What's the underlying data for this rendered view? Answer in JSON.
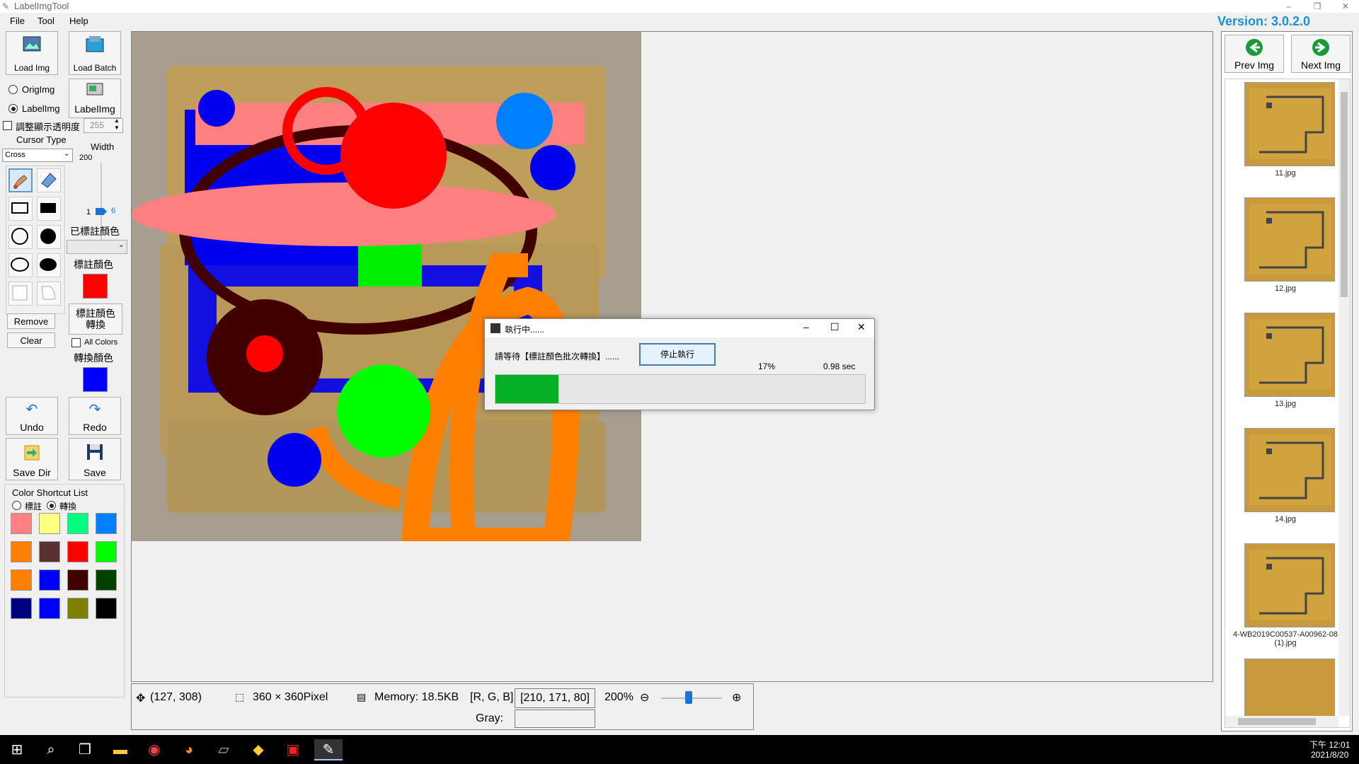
{
  "window": {
    "title": "LabelImgTool",
    "minimize": "–",
    "restore": "❐",
    "close": "✕"
  },
  "menu": [
    {
      "label": "File"
    },
    {
      "label": "Tool"
    },
    {
      "label": "Help"
    }
  ],
  "version": "Version: 3.0.2.0",
  "left": {
    "load_img": "Load Img",
    "load_batch": "Load Batch",
    "orig_img": "OrigImg",
    "label_img_radio": "LabelImg",
    "label_img_button": "LabelImg",
    "opacity_label": "調整顯示透明度",
    "opacity_value": "255",
    "cursor_type_label": "Cursor Type",
    "cursor_type_value": "Cross",
    "width_label": "Width",
    "width_max": "200",
    "width_min": "1",
    "width_value": "6",
    "marked_color_label": "已標註顏色",
    "label_color_label": "標註顏色",
    "label_color": "#ff0000",
    "convert_button": "標註顏色轉換",
    "remove": "Remove",
    "clear": "Clear",
    "all_colors": "All Colors",
    "convert_color_label": "轉換顏色",
    "convert_color": "#0000ff",
    "undo": "Undo",
    "redo": "Redo",
    "save_dir": "Save Dir",
    "save": "Save",
    "shortcut_title": "Color Shortcut List",
    "shortcut_opt1": "標註",
    "shortcut_opt2": "轉換",
    "palette": [
      "#ff8080",
      "#ffff80",
      "#00ff80",
      "#0080ff",
      "#ff8000",
      "#5a3030",
      "#ff0000",
      "#00ff00",
      "#ff8000",
      "#0000ff",
      "#400000",
      "#004000",
      "#000080",
      "#0000ff",
      "#808000",
      "#000000"
    ]
  },
  "status": {
    "coords": "(127, 308)",
    "size": "360 × 360Pixel",
    "memory": "Memory: 18.5KB",
    "rgb_label": "[R, G, B]:",
    "rgb_value": "[210, 171, 80]",
    "zoom": "200%",
    "zoom_level": 0.45,
    "gray_label": "Gray:",
    "gray_value": ""
  },
  "dialog": {
    "title": "執行中......",
    "message": "請等待【標註顏色批次轉換】......",
    "stop_button": "停止執行",
    "percent": "17%",
    "time": "0.98 sec",
    "progress": 0.17,
    "bar_color": "#06b025"
  },
  "thumbs": {
    "prev": "Prev Img",
    "next": "Next Img",
    "items": [
      {
        "name": "11.jpg"
      },
      {
        "name": "12.jpg"
      },
      {
        "name": "13.jpg"
      },
      {
        "name": "14.jpg"
      },
      {
        "name": "4-WB2019C00537-A00962-08 (1).jpg"
      }
    ]
  },
  "taskbar": {
    "time": "下午 12:01",
    "date": "2021/8/20",
    "icons": [
      "windows-icon",
      "search-icon",
      "task-view-icon",
      "file-explorer-icon",
      "chrome-icon",
      "firefox-icon",
      "notepad-icon",
      "app-icon",
      "acrobat-icon",
      "labelimg-icon"
    ]
  }
}
